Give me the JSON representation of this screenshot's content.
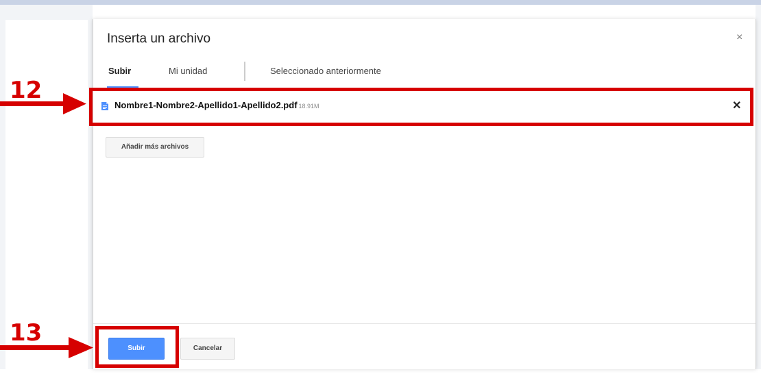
{
  "dialog": {
    "title": "Inserta un archivo",
    "close_glyph": "×"
  },
  "tabs": [
    {
      "label": "Subir",
      "active": true
    },
    {
      "label": "Mi unidad",
      "active": false
    },
    {
      "label": "Seleccionado anteriormente",
      "active": false
    }
  ],
  "file": {
    "icon": "document-icon",
    "name": "Nombre1-Nombre2-Apellido1-Apellido2.pdf",
    "size": "18.91M",
    "remove_glyph": "✕"
  },
  "add_more_label": "Añadir más archivos",
  "footer": {
    "upload_label": "Subir",
    "cancel_label": "Cancelar"
  },
  "annotations": {
    "step1": "12",
    "step2": "13",
    "color": "#d60000"
  },
  "colors": {
    "accent": "#4d90fe"
  }
}
